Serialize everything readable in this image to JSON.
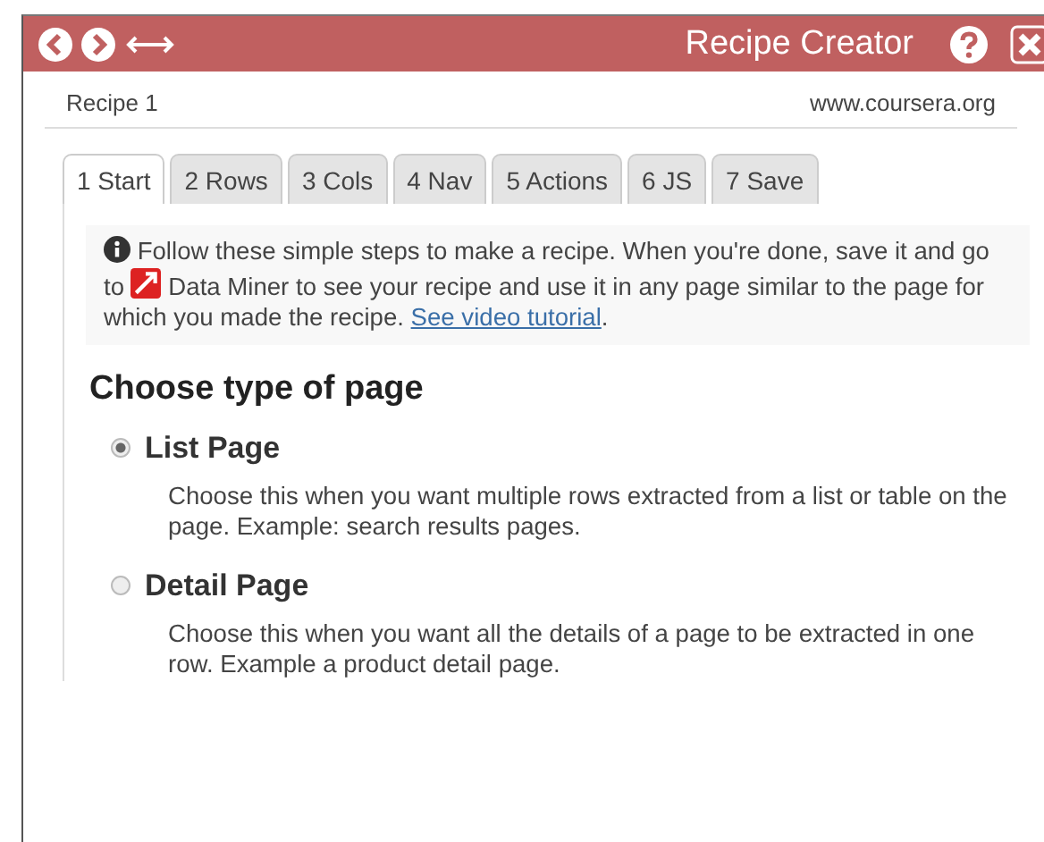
{
  "window": {
    "title": "Recipe Creator"
  },
  "recipe": {
    "name": "Recipe 1",
    "site": "www.coursera.org"
  },
  "tabs": [
    {
      "label": "1 Start",
      "selected": true
    },
    {
      "label": "2 Rows",
      "selected": false
    },
    {
      "label": "3 Cols",
      "selected": false
    },
    {
      "label": "4 Nav",
      "selected": false
    },
    {
      "label": "5 Actions",
      "selected": false
    },
    {
      "label": "6 JS",
      "selected": false
    },
    {
      "label": "7 Save",
      "selected": false
    }
  ],
  "info": {
    "before": "Follow these simple steps to make a recipe. When you're done, save it and go to",
    "middle": "Data Miner to see your recipe and use it in any page similar to the page for which you made the recipe.",
    "link": "See video tutorial",
    "after": "."
  },
  "heading": "Choose type of page",
  "options": [
    {
      "label": "List Page",
      "selected": true,
      "description": "Choose this when you want multiple rows extracted from a list or table on the page. Example: search results pages."
    },
    {
      "label": "Detail Page",
      "selected": false,
      "description": "Choose this when you want all the details of a page to be extracted in one row. Example a product detail page."
    }
  ]
}
